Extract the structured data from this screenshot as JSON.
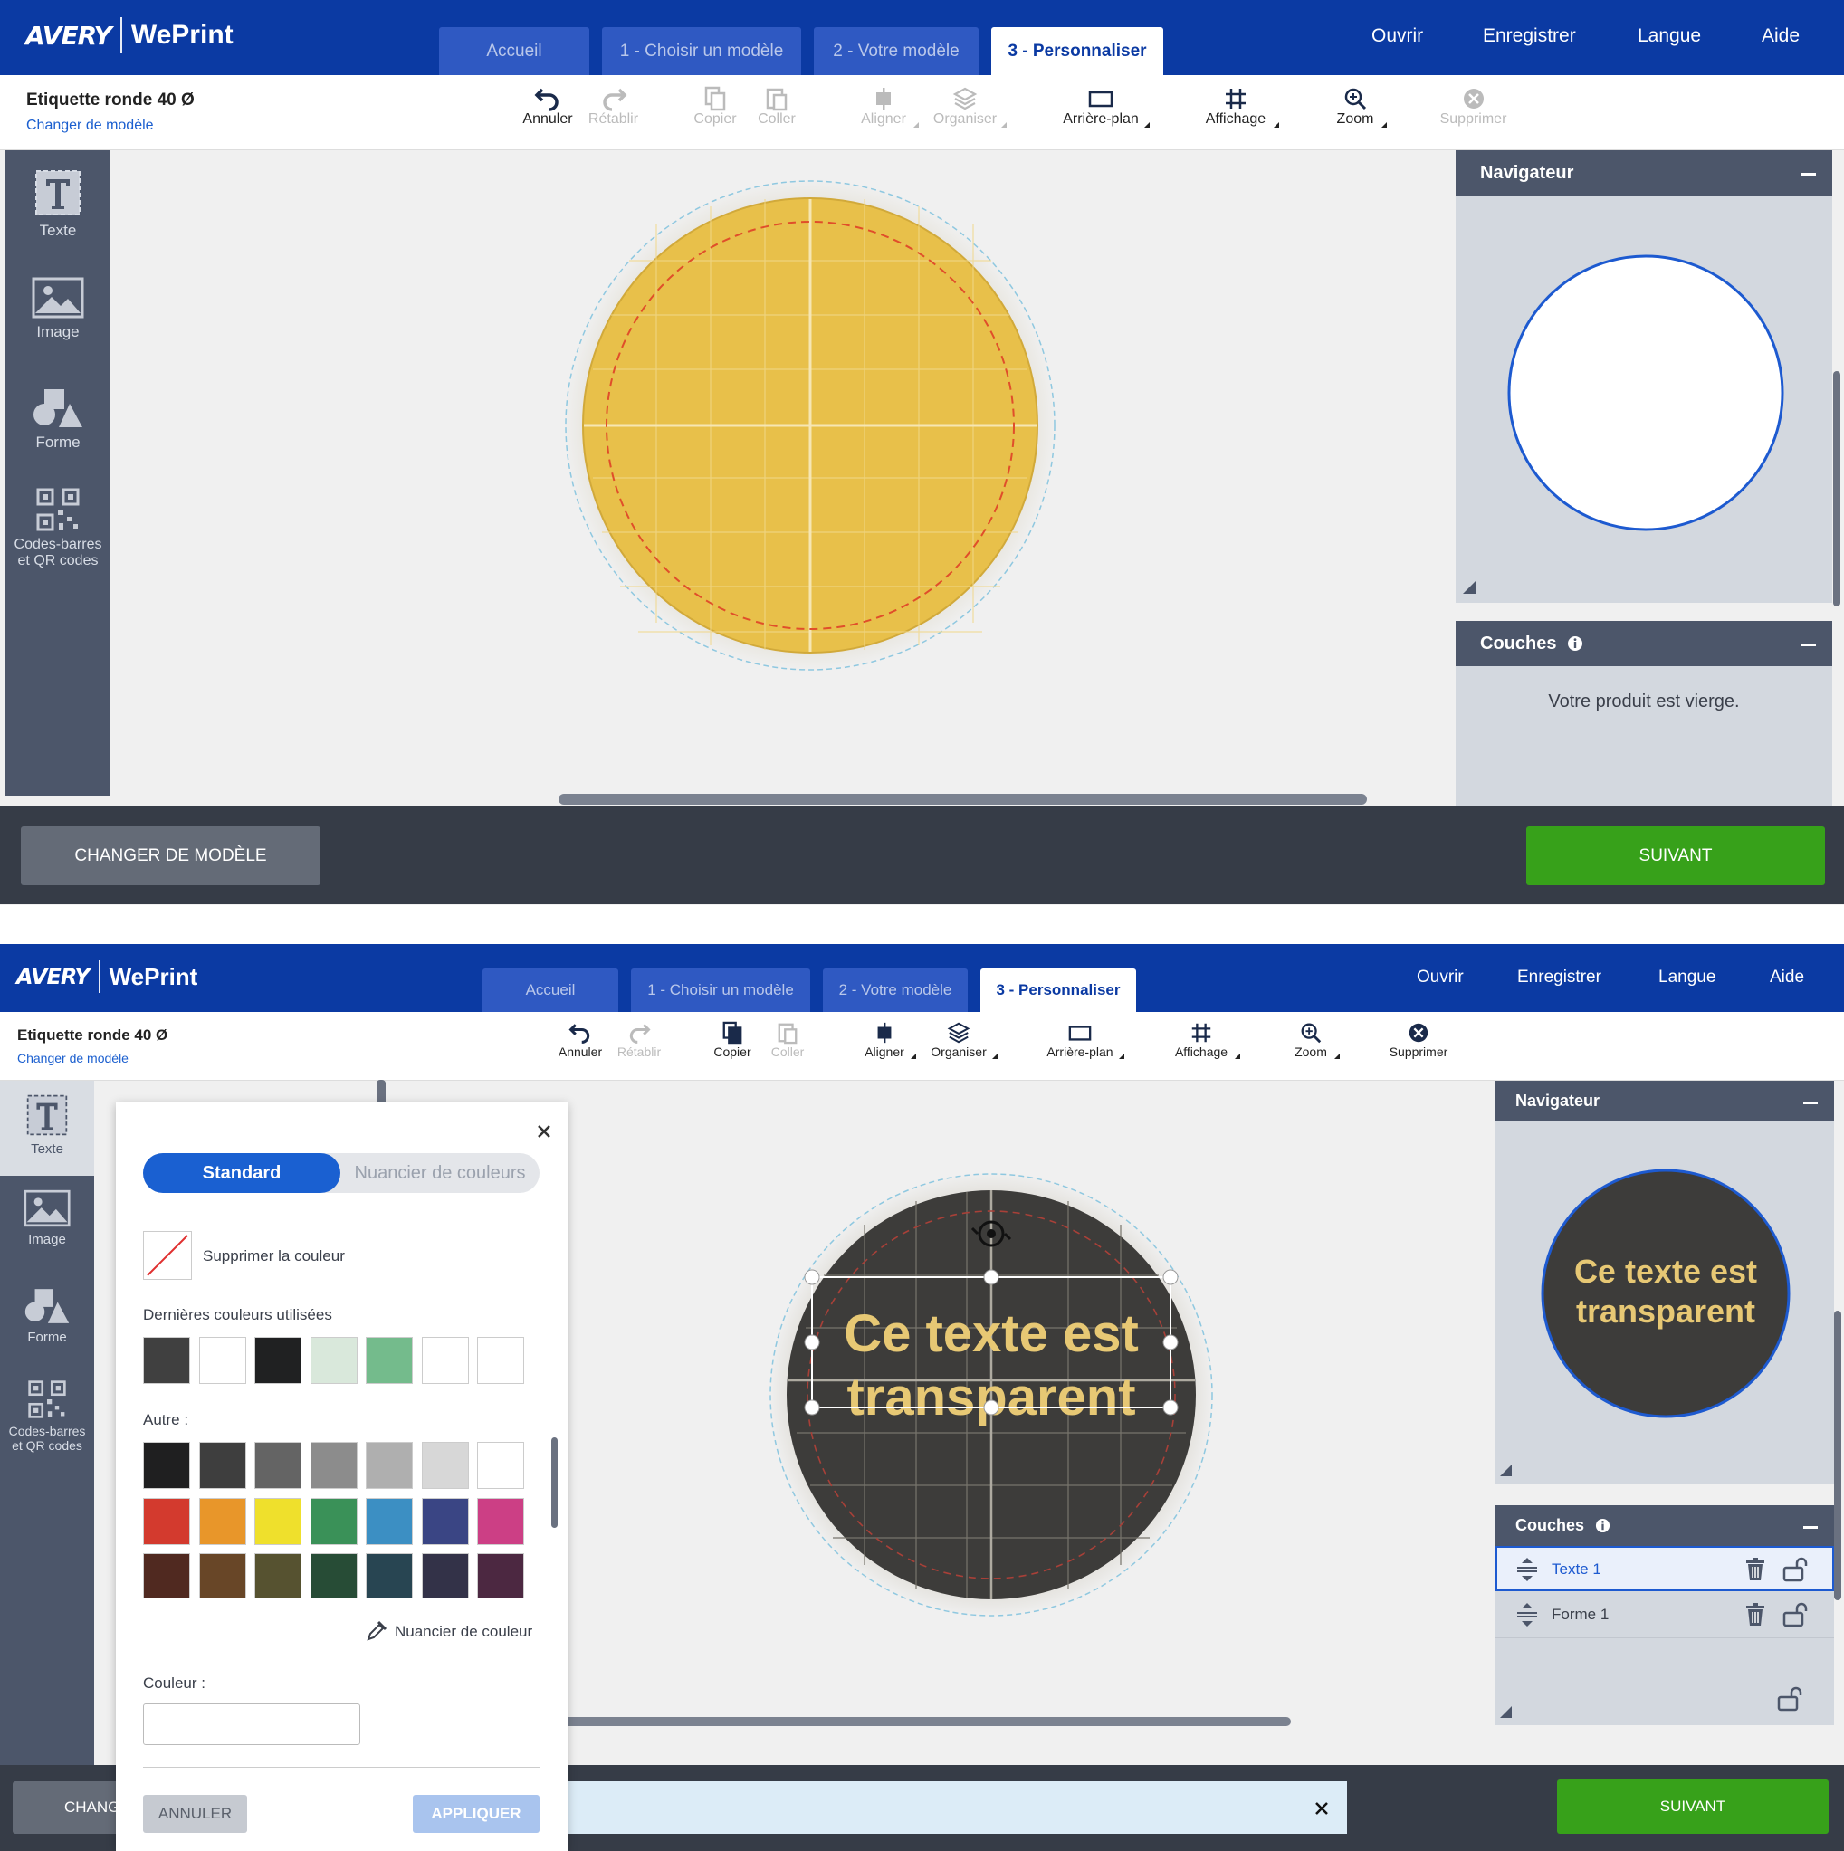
{
  "header": {
    "brand": "AVERY",
    "product": "WePrint",
    "tabs": [
      "Accueil",
      "1 - Choisir un modèle",
      "2 - Votre modèle",
      "3 - Personnaliser"
    ],
    "nav": [
      "Ouvrir",
      "Enregistrer",
      "Langue",
      "Aide"
    ]
  },
  "product": {
    "name": "Etiquette ronde 40 Ø",
    "change_link": "Changer de modèle"
  },
  "toolbar": {
    "undo": "Annuler",
    "redo": "Rétablir",
    "copy": "Copier",
    "paste": "Coller",
    "align": "Aligner",
    "arrange": "Organiser",
    "background": "Arrière-plan",
    "display": "Affichage",
    "zoom": "Zoom",
    "delete": "Supprimer"
  },
  "leftbar": {
    "text": "Texte",
    "image": "Image",
    "shape": "Forme",
    "codes_line1": "Codes-barres",
    "codes_line2": "et QR codes"
  },
  "panels": {
    "navigator": "Navigateur",
    "layers": "Couches",
    "empty": "Votre produit est vierge.",
    "layer_items": [
      "Texte 1",
      "Forme 1"
    ]
  },
  "footer": {
    "change": "CHANGER DE MODÈLE",
    "change_cut": "CHANG",
    "next": "SUIVANT"
  },
  "design": {
    "text_line1": "Ce texte est",
    "text_line2": "transparent",
    "fill_top": "#e8c04a",
    "fill_bottom": "#3d3c3a",
    "text_color": "#e7c874"
  },
  "color_popup": {
    "tab_standard": "Standard",
    "tab_picker": "Nuancier de couleurs",
    "remove_color": "Supprimer la couleur",
    "recent_label": "Dernières couleurs utilisées",
    "recent": [
      "#404040",
      "#ffffff",
      "#202122",
      "#d9e8db",
      "#74bb8c",
      "#ffffff",
      "#ffffff"
    ],
    "other_label": "Autre :",
    "grid": [
      [
        "#1f1f20",
        "#3e3e3e",
        "#646464",
        "#8c8c8c",
        "#afafaf",
        "#d7d7d7",
        "#ffffff"
      ],
      [
        "#d33a2e",
        "#e8962a",
        "#efe02c",
        "#3a9158",
        "#3c8fc3",
        "#3a4584",
        "#cc3f85"
      ],
      [
        "#502920",
        "#684627",
        "#565230",
        "#274c36",
        "#284552",
        "#333248",
        "#4c2841"
      ],
      [
        "#8c4f50",
        "#9b7650",
        "#8e8955",
        "#5c8c69",
        "#5d7f8a",
        "#566092",
        "#8e5577"
      ]
    ],
    "picker_link": "Nuancier de couleur",
    "color_label": "Couleur :",
    "color_value": "",
    "cancel": "ANNULER",
    "apply": "APPLIQUER"
  }
}
